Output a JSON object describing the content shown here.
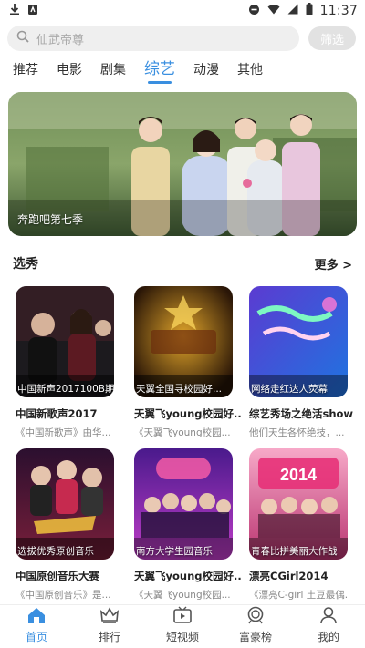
{
  "status_bar": {
    "time": "11:37"
  },
  "search": {
    "placeholder": "仙武帝尊",
    "filter_label": "筛选"
  },
  "tabs": [
    {
      "label": "推荐",
      "active": false
    },
    {
      "label": "电影",
      "active": false
    },
    {
      "label": "剧集",
      "active": false
    },
    {
      "label": "综艺",
      "active": true
    },
    {
      "label": "动漫",
      "active": false
    },
    {
      "label": "其他",
      "active": false
    }
  ],
  "banner": {
    "caption": "奔跑吧第七季"
  },
  "section": {
    "title": "选秀",
    "more_label": "更多 >"
  },
  "cards": [
    {
      "thumb_caption": "中国新声2017100B期",
      "title": "中国新歌声2017",
      "subtitle": "《中国新歌声》由华...",
      "accent": "#c0392b"
    },
    {
      "thumb_caption": "天翼全国寻校园好...",
      "title": "天翼飞young校园好...",
      "subtitle": "《天翼飞young校园...",
      "accent": "#d4a017"
    },
    {
      "thumb_caption": "网络走红达人荧幕",
      "title": "综艺秀场之绝活show",
      "subtitle": "他们天生各怀绝技，...",
      "accent": "#2a7de1"
    },
    {
      "thumb_caption": "选拔优秀原创音乐",
      "title": "中国原创音乐大赛",
      "subtitle": "《中国原创音乐》是...",
      "accent": "#8e2ec4"
    },
    {
      "thumb_caption": "南方大学生园音乐",
      "title": "天翼飞young校园好...",
      "subtitle": "《天翼飞young校园...",
      "accent": "#6a2bb5"
    },
    {
      "thumb_caption": "青春比拼美丽大作战",
      "title": "漂亮CGirl2014",
      "subtitle": "《漂亮C-girl 土豆最偶...",
      "accent": "#e0457b"
    }
  ],
  "bottom_nav": [
    {
      "label": "首页",
      "icon": "home-icon",
      "active": true
    },
    {
      "label": "排行",
      "icon": "crown-icon",
      "active": false
    },
    {
      "label": "短视频",
      "icon": "video-icon",
      "active": false
    },
    {
      "label": "富豪榜",
      "icon": "medal-icon",
      "active": false
    },
    {
      "label": "我的",
      "icon": "profile-icon",
      "active": false
    }
  ],
  "colors": {
    "accent": "#3a8fe0"
  }
}
